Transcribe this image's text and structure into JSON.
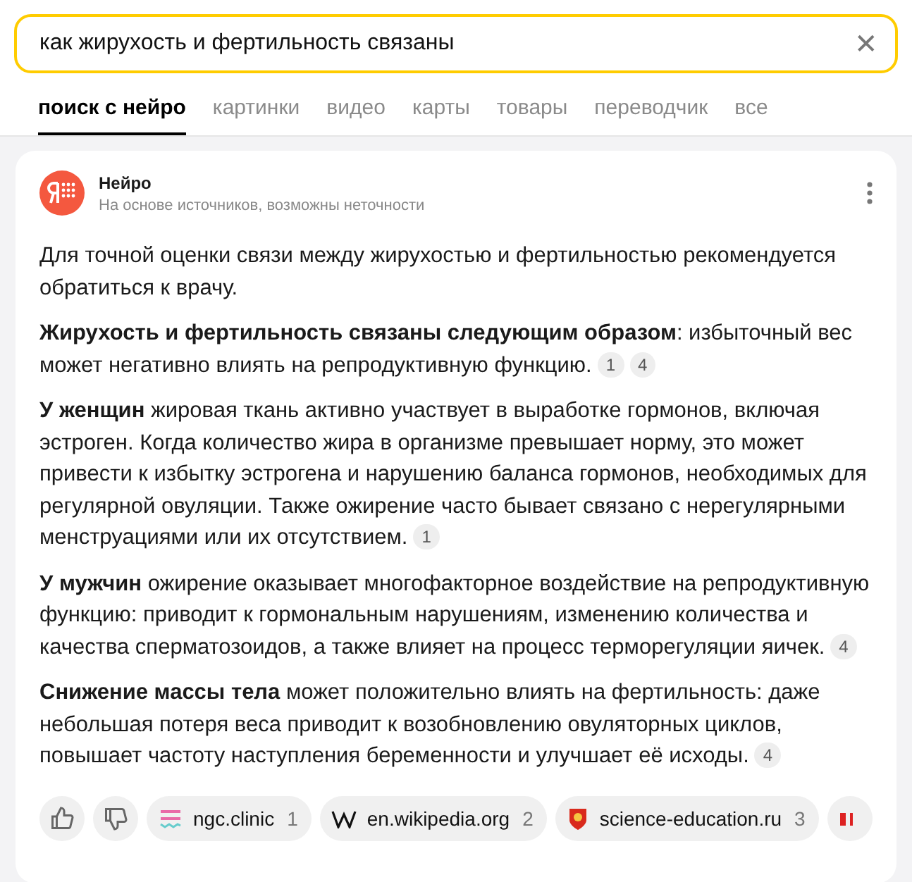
{
  "search": {
    "value": "как жирухость и фертильность связаны",
    "clear": "✕"
  },
  "tabs": [
    {
      "label": "поиск с нейро",
      "selected": true
    },
    {
      "label": "картинки",
      "selected": false
    },
    {
      "label": "видео",
      "selected": false
    },
    {
      "label": "карты",
      "selected": false
    },
    {
      "label": "товары",
      "selected": false
    },
    {
      "label": "переводчик",
      "selected": false
    },
    {
      "label": "все",
      "selected": false
    }
  ],
  "answer": {
    "title": "Нейро",
    "subtitle": "На основе источников, возможны неточности",
    "paragraphs": [
      {
        "text": "Для точной оценки связи между жирухостью и фертильностью рекомендуется обратиться к врачу."
      },
      {
        "text": "**Жирухость и фертильность связаны следующим образом**: избыточный вес может негативно влиять на репродуктивную функцию.",
        "refs": [
          "1",
          "4"
        ]
      },
      {
        "text": "**У женщин** жировая ткань активно участвует в выработке гормонов, включая эстроген. Когда количество жира в организме превышает норму, это может привести к избытку эстрогена и нарушению баланса гормонов, необходимых для регулярной овуляции. Также ожирение часто бывает связано с нерегулярными менструациями или их отсутствием.",
        "refs": [
          "1"
        ]
      },
      {
        "text": "**У мужчин** ожирение оказывает многофакторное воздействие на репродуктивную функцию: приводит к гормональным нарушениям, изменению количества и качества сперматозоидов, а также влияет на процесс терморегуляции яичек.",
        "refs": [
          "4"
        ]
      },
      {
        "text": "**Снижение массы тела** может положительно влиять на фертильность: даже небольшая потеря веса приводит к возобновлению овуляторных циклов, повышает частоту наступления беременности и улучшает её исходы.",
        "refs": [
          "4"
        ]
      }
    ],
    "sources": [
      {
        "kind": "ngc",
        "name": "ngc.clinic",
        "number": "1"
      },
      {
        "kind": "wiki",
        "name": "en.wikipedia.org",
        "number": "2"
      },
      {
        "kind": "crest",
        "name": "science-education.ru",
        "number": "3"
      },
      {
        "kind": "cut"
      }
    ]
  }
}
